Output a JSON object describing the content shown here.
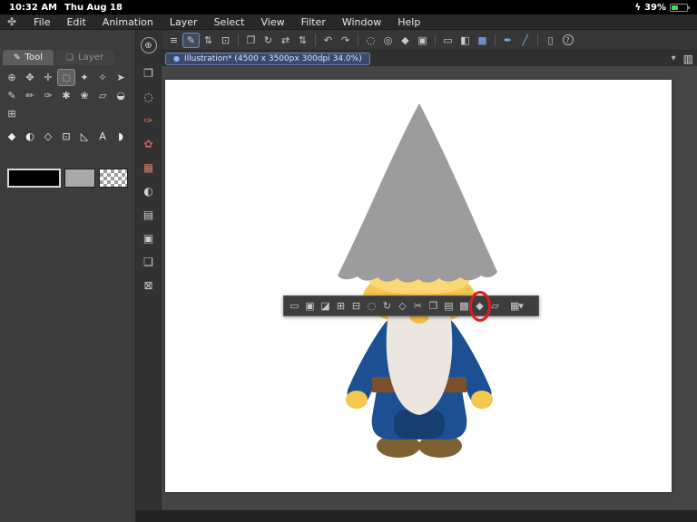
{
  "status_bar": {
    "time": "10:32 AM",
    "date": "Thu Aug 18",
    "charging_glyph": "ϟ",
    "battery_percent": "39%"
  },
  "menu_bar": {
    "logo_glyph": "✤",
    "items": [
      "File",
      "Edit",
      "Animation",
      "Layer",
      "Select",
      "View",
      "Filter",
      "Window",
      "Help"
    ]
  },
  "main_toolbar": {
    "icons": [
      {
        "name": "main-menu-icon",
        "glyph": "≡"
      },
      {
        "name": "edit-pen-icon",
        "glyph": "✎",
        "boxed": true
      },
      {
        "name": "tool-switch-icon",
        "glyph": "⇅"
      },
      {
        "name": "photo-import-icon",
        "glyph": "⊡"
      },
      {
        "name": "toolbar-separator",
        "sep": true
      },
      {
        "name": "export-icon",
        "glyph": "❐"
      },
      {
        "name": "rotate-canvas-icon",
        "glyph": "↻"
      },
      {
        "name": "flip-canvas-icon",
        "glyph": "⇄"
      },
      {
        "name": "view-chevrons-icon",
        "glyph": "⇅"
      },
      {
        "name": "toolbar-separator",
        "sep": true
      },
      {
        "name": "undo-icon",
        "glyph": "↶"
      },
      {
        "name": "redo-icon",
        "glyph": "↷"
      },
      {
        "name": "toolbar-separator",
        "sep": true
      },
      {
        "name": "selection-ring-icon",
        "glyph": "◌"
      },
      {
        "name": "deselect-icon",
        "glyph": "◎"
      },
      {
        "name": "fill-tool-icon",
        "glyph": "◆"
      },
      {
        "name": "crop-icon",
        "glyph": "▣"
      },
      {
        "name": "toolbar-separator",
        "sep": true
      },
      {
        "name": "rect-select-icon",
        "glyph": "▭"
      },
      {
        "name": "tone-select-icon",
        "glyph": "◧"
      },
      {
        "name": "active-area-icon",
        "glyph": "■",
        "color": "#6f8fca"
      },
      {
        "name": "toolbar-separator",
        "sep": true
      },
      {
        "name": "pen-mode-icon",
        "glyph": "✒",
        "color": "#7fb2e8"
      },
      {
        "name": "line-mode-icon",
        "glyph": "╱",
        "color": "#7fb2e8"
      },
      {
        "name": "toolbar-separator",
        "sep": true
      },
      {
        "name": "device-icon",
        "glyph": "▯"
      },
      {
        "name": "help-icon",
        "glyph": "?",
        "circled": true
      }
    ]
  },
  "document_tab": {
    "dot": "●",
    "title": "Illustration* (4500 x 3500px 300dpi 34.0%)",
    "chevron": "▾",
    "panel_toggle": "▥"
  },
  "tool_panel": {
    "tabs": [
      {
        "name": "tab-tool",
        "label": "Tool",
        "glyph": "✎",
        "active": true
      },
      {
        "name": "tab-layer",
        "label": "Layer",
        "glyph": "❏"
      }
    ],
    "row1": [
      {
        "name": "zoom-tool",
        "glyph": "⊕"
      },
      {
        "name": "hand-tool",
        "glyph": "✥"
      },
      {
        "name": "move-tool",
        "glyph": "✛"
      },
      {
        "name": "selection-tool",
        "glyph": "◌",
        "active": true
      },
      {
        "name": "auto-select-tool",
        "glyph": "✦"
      },
      {
        "name": "eyedropper-tool",
        "glyph": "✧"
      },
      {
        "name": "operation-tool",
        "glyph": "➤"
      }
    ],
    "row2": [
      {
        "name": "pen-tool",
        "glyph": "✎"
      },
      {
        "name": "pencil-tool",
        "glyph": "✏"
      },
      {
        "name": "brush-tool",
        "glyph": "✑"
      },
      {
        "name": "airbrush-tool",
        "glyph": "✱"
      },
      {
        "name": "decoration-tool",
        "glyph": "❀"
      },
      {
        "name": "eraser-tool",
        "glyph": "▱"
      },
      {
        "name": "blend-tool",
        "glyph": "◒"
      }
    ],
    "row3": [
      {
        "name": "correction-tool",
        "glyph": "⊞"
      }
    ],
    "row4": [
      {
        "name": "fill-subtool",
        "glyph": "◆"
      },
      {
        "name": "gradient-subtool",
        "glyph": "◐"
      },
      {
        "name": "figure-subtool",
        "glyph": "◇"
      },
      {
        "name": "frame-subtool",
        "glyph": "⊡"
      },
      {
        "name": "ruler-subtool",
        "glyph": "◺"
      },
      {
        "name": "text-subtool",
        "glyph": "A"
      },
      {
        "name": "balloon-subtool",
        "glyph": "◗"
      }
    ],
    "colors": {
      "main_hex": "#000000",
      "sub_hex": "#a9a9a9",
      "transparent_label": "transparent"
    }
  },
  "quick_bar": {
    "icons": [
      {
        "name": "quick-zoom-icon",
        "glyph": "⊕",
        "circled": true
      },
      {
        "name": "subtool-panel-icon",
        "glyph": "❐"
      },
      {
        "name": "tool-property-panel-icon",
        "glyph": "◌"
      },
      {
        "name": "brush-size-panel-icon",
        "glyph": "✑",
        "color": "#cd7b66"
      },
      {
        "name": "color-wheel-panel-icon",
        "glyph": "✿",
        "color": "#cc5f5f"
      },
      {
        "name": "color-set-panel-icon",
        "glyph": "▦",
        "color": "#cd7b66"
      },
      {
        "name": "color-mix-panel-icon",
        "glyph": "◐"
      },
      {
        "name": "material-panel-icon",
        "glyph": "▤"
      },
      {
        "name": "navigator-panel-icon",
        "glyph": "▣"
      },
      {
        "name": "layer-panel-icon",
        "glyph": "❏"
      },
      {
        "name": "close-panels-icon",
        "glyph": "⊠"
      }
    ]
  },
  "selection_launcher": {
    "icons": [
      {
        "name": "deselect-icon",
        "glyph": "▭"
      },
      {
        "name": "reselect-icon",
        "glyph": "▣"
      },
      {
        "name": "invert-selection-icon",
        "glyph": "◪"
      },
      {
        "name": "expand-selection-icon",
        "glyph": "⊞"
      },
      {
        "name": "shrink-selection-icon",
        "glyph": "⊟"
      },
      {
        "name": "border-selection-icon",
        "glyph": "◌"
      },
      {
        "name": "rotate-selection-icon",
        "glyph": "↻"
      },
      {
        "name": "scale-selection-icon",
        "glyph": "◇"
      },
      {
        "name": "cut-icon",
        "glyph": "✂"
      },
      {
        "name": "copy-icon",
        "glyph": "❐"
      },
      {
        "name": "paste-icon",
        "glyph": "▤"
      },
      {
        "name": "tone-icon",
        "glyph": "▩"
      },
      {
        "name": "fill-icon",
        "glyph": "◆",
        "highlighted": true
      },
      {
        "name": "erase-selection-icon",
        "glyph": "▱"
      },
      {
        "name": "launcher-settings-icon",
        "glyph": "▦▾",
        "wide": true
      }
    ]
  },
  "annotation": {
    "circle_color": "#e01b1b"
  },
  "gnome": {
    "hat": "#9c9c9c",
    "skin": "#f6c74e",
    "skin_light": "#fbd874",
    "beard": "#ebe7e0",
    "robe": "#1d4f93",
    "robe_dark": "#163f70",
    "belt": "#7c4e2a",
    "buckle": "#9a6a3e",
    "feet": "#7e6132",
    "nose": "#f3bd45"
  }
}
